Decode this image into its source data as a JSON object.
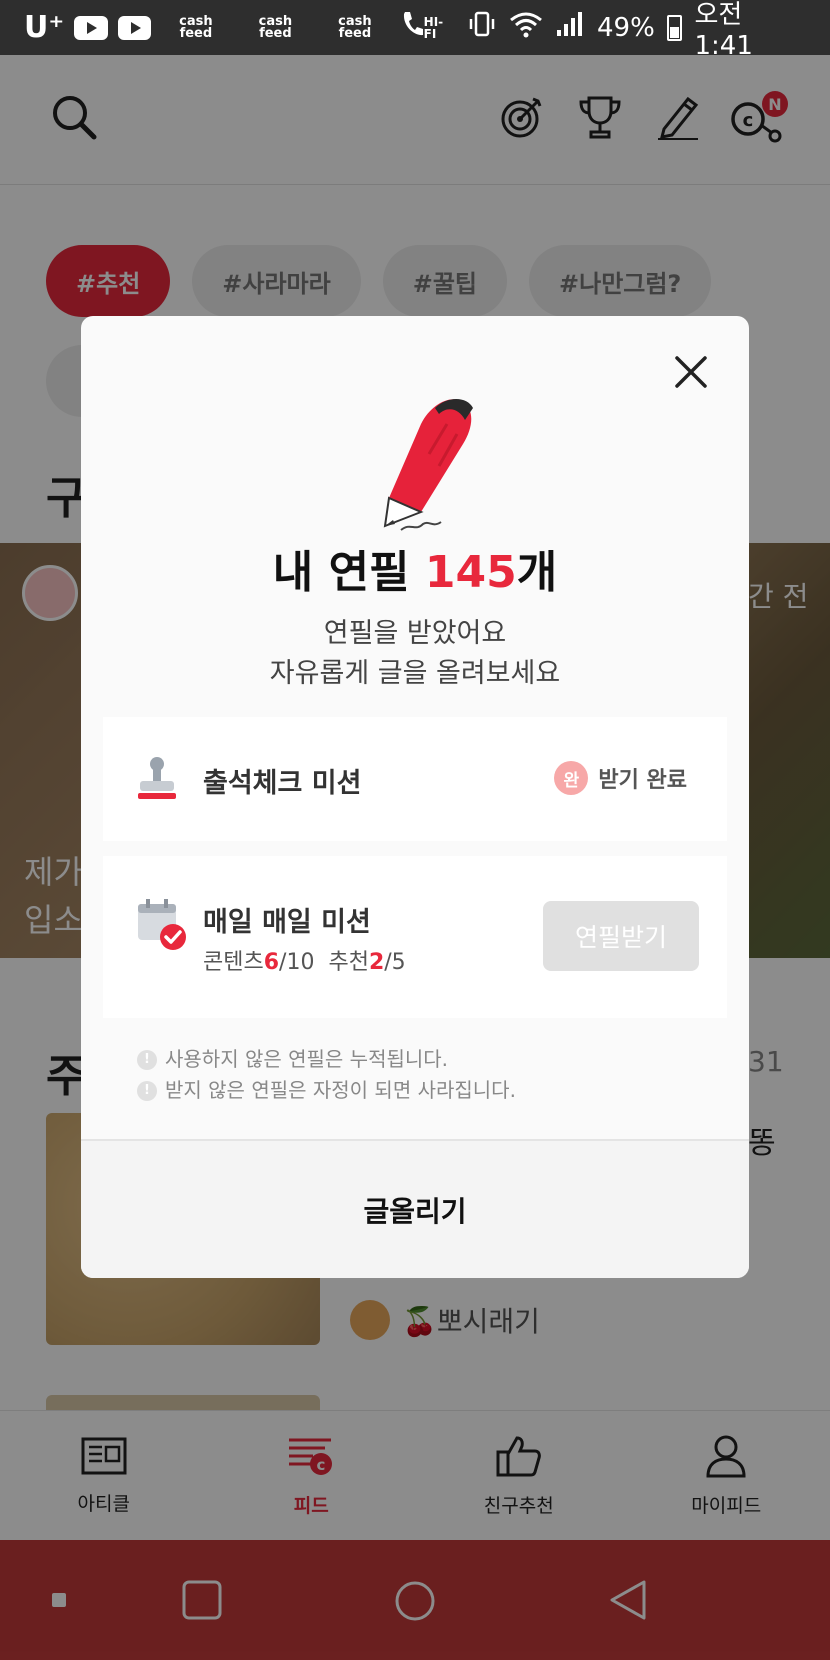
{
  "statusbar": {
    "carrier": "U⁺",
    "cash_feed_label": "cash feed",
    "hifi": "HI-FI",
    "battery": "49%",
    "time": "오전 1:41"
  },
  "header": {
    "notification_badge": "N"
  },
  "background": {
    "chips": [
      "#추천",
      "#사라마라",
      "#꿀팁",
      "#나만그럼?"
    ],
    "section_heading": "구",
    "banner_text_line1": "제가",
    "banner_text_line2": "입소",
    "banner_time": "간 전",
    "section2_heading": "주",
    "count_fragment": "31",
    "title_fragment": "똥",
    "author_name": "🍒뽀시래기"
  },
  "bottom_nav": {
    "items": [
      {
        "label": "아티클"
      },
      {
        "label": "피드"
      },
      {
        "label": "친구추천"
      },
      {
        "label": "마이피드"
      }
    ]
  },
  "modal": {
    "title_prefix": "내 연필 ",
    "pencil_count": "145",
    "title_suffix": "개",
    "subtitle_line1": "연필을 받았어요",
    "subtitle_line2": "자유롭게 글을 올려보세요",
    "mission1": {
      "title": "출석체크 미션",
      "done_badge": "완",
      "done_label": "받기 완료"
    },
    "mission2": {
      "title": "매일 매일 미션",
      "content_label": "콘텐츠",
      "content_done": "6",
      "content_total": "/10",
      "recommend_label": "추천",
      "recommend_done": "2",
      "recommend_total": "/5",
      "button_label": "연필받기"
    },
    "notes": [
      "사용하지 않은 연필은 누적됩니다.",
      "받지 않은 연필은 자정이 되면 사라집니다."
    ],
    "note_icon": "!",
    "write_button": "글올리기"
  },
  "colors": {
    "accent": "#e8283c",
    "nav_bar": "#c23a3a"
  }
}
